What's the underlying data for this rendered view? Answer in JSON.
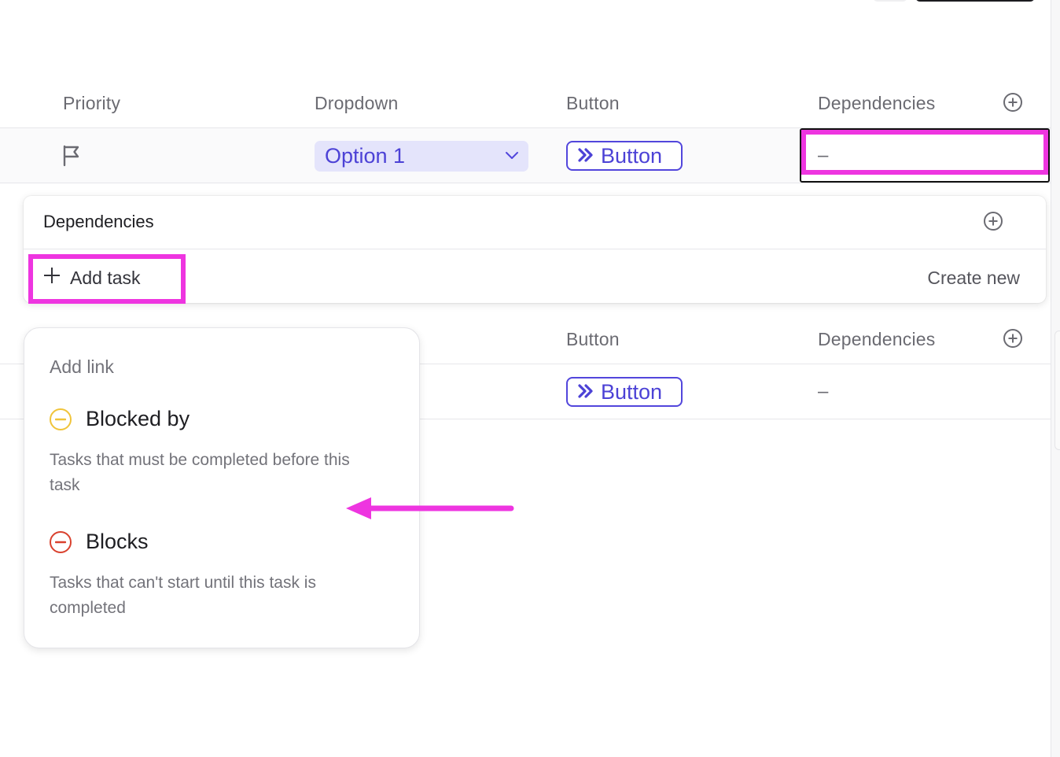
{
  "table": {
    "headers": {
      "priority": "Priority",
      "dropdown": "Dropdown",
      "button": "Button",
      "dependencies": "Dependencies"
    },
    "row1": {
      "dropdown_value": "Option 1",
      "button_label": "Button",
      "dependencies_value": "–"
    },
    "row2": {
      "button_label": "Button",
      "dependencies_value": "–"
    },
    "secondary_headers": {
      "button": "Button",
      "dependencies": "Dependencies"
    }
  },
  "dependencies_popover": {
    "title": "Dependencies",
    "add_task_label": "Add task",
    "create_new_label": "Create new"
  },
  "add_link_menu": {
    "heading": "Add link",
    "items": [
      {
        "label": "Blocked by",
        "description": "Tasks that must be completed before this task",
        "icon": "minus-circle-icon",
        "color": "#f0c43a"
      },
      {
        "label": "Blocks",
        "description": "Tasks that can't start until this task is completed",
        "icon": "minus-circle-icon",
        "color": "#d9412e"
      }
    ]
  },
  "colors": {
    "accent": "#5246dc",
    "highlight": "#ee35e0",
    "dropdown_bg": "#e4e4fb"
  }
}
